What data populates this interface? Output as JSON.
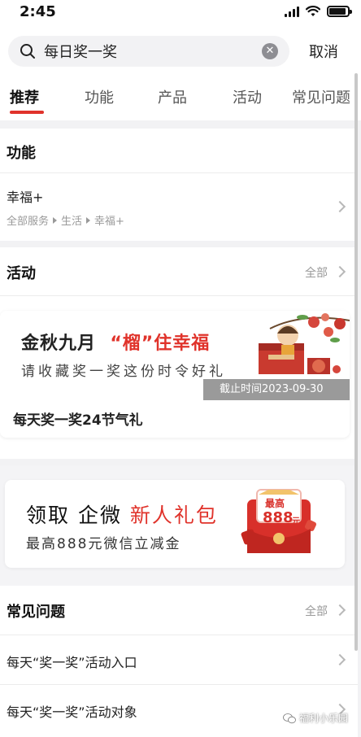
{
  "status": {
    "time": "2:45"
  },
  "search": {
    "value": "每日奖一奖",
    "cancel": "取消"
  },
  "tabs": [
    {
      "label": "推荐",
      "active": true
    },
    {
      "label": "功能"
    },
    {
      "label": "产品"
    },
    {
      "label": "活动"
    },
    {
      "label": "常见问题"
    }
  ],
  "features": {
    "title": "功能",
    "item": {
      "title": "幸福+",
      "crumbs": [
        "全部服务",
        "生活",
        "幸福+"
      ]
    }
  },
  "activities": {
    "title": "活动",
    "more": "全部",
    "banner": {
      "title_before": "金秋九月",
      "title_highlight": "“榴”住幸福",
      "subtitle": "请收藏奖一奖这份时令好礼",
      "deadline": "截止时间2023-09-30",
      "caption": "每天奖一奖24节气礼"
    }
  },
  "promo": {
    "title_before": "领取 企微",
    "title_highlight": "新人礼包",
    "subtitle": "最高888元微信立减金",
    "badge_top": "最高",
    "badge_amount": "888",
    "badge_unit": "元"
  },
  "faq": {
    "title": "常见问题",
    "more": "全部",
    "items": [
      {
        "label": "每天“奖一奖”活动入口"
      },
      {
        "label": "每天“奖一奖”活动对象"
      }
    ]
  },
  "watermark": "福利小乐园",
  "colors": {
    "accent": "#e0332b"
  }
}
